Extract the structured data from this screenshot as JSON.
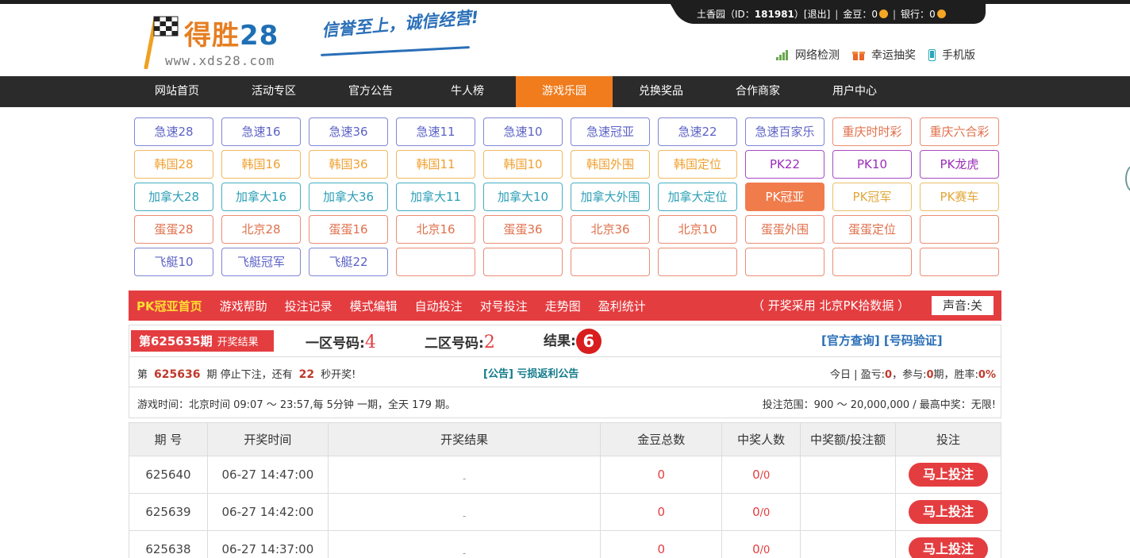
{
  "header": {
    "logo_name": "得胜",
    "logo_num": "28",
    "logo_url": "www.xds28.com",
    "slogan": "信誉至上，诚信经营!",
    "user": {
      "name": "土香园",
      "id_label": "（ID：",
      "id": "181981",
      "id_close": "）",
      "logout": "[退出]",
      "gold_label": "金豆：",
      "gold": "0",
      "bank_label": "银行：",
      "bank": "0"
    },
    "quicklinks": [
      "网络检测",
      "幸运抽奖",
      "手机版"
    ]
  },
  "nav": [
    "网站首页",
    "活动专区",
    "官方公告",
    "牛人榜",
    "游戏乐园",
    "兑换奖品",
    "合作商家",
    "用户中心"
  ],
  "games": [
    [
      "急速28",
      "急速16",
      "急速36",
      "急速11",
      "急速10",
      "急速冠亚",
      "急速22",
      "急速百家乐",
      "重庆时时彩",
      "重庆六合彩"
    ],
    [
      "韩国28",
      "韩国16",
      "韩国36",
      "韩国11",
      "韩国10",
      "韩国外围",
      "韩国定位",
      "PK22",
      "PK10",
      "PK龙虎"
    ],
    [
      "加拿大28",
      "加拿大16",
      "加拿大36",
      "加拿大11",
      "加拿大10",
      "加拿大外围",
      "加拿大定位",
      "PK冠亚",
      "PK冠军",
      "PK赛车"
    ],
    [
      "蛋蛋28",
      "北京28",
      "蛋蛋16",
      "北京16",
      "蛋蛋36",
      "北京36",
      "北京10",
      "蛋蛋外围",
      "蛋蛋定位",
      ""
    ],
    [
      "飞艇10",
      "飞艇冠军",
      "飞艇22",
      "",
      "",
      "",
      "",
      "",
      "",
      ""
    ]
  ],
  "subnav": {
    "home": "PK冠亚首页",
    "items": [
      "游戏帮助",
      "投注记录",
      "模式编辑",
      "自动投注",
      "对号投注",
      "走势图",
      "盈利统计"
    ],
    "source": "（ 开奖采用 北京PK拾数据 ）",
    "sound": "声音:关"
  },
  "info": {
    "period": "第625635期",
    "period_label": "开奖结果",
    "zone1_label": "一区号码:",
    "zone1": "4",
    "zone2_label": "二区号码:",
    "zone2": "2",
    "result_label": "结果:",
    "result": "6",
    "official": "[官方查询] [号码验证]",
    "next_prefix": "第",
    "next_period": "625636",
    "next_mid": "期 停止下注，还有",
    "countdown": "22",
    "next_suffix": "秒开奖!",
    "notice": "[公告] 亏损返利公告",
    "today_a": "今日 | 盈亏:",
    "today_profit": "0",
    "today_b": "，参与:",
    "today_join": "0",
    "today_c": "期，胜率:",
    "today_rate": "0%",
    "game_time": "游戏时间：北京时间 09:07 ～ 23:57,每 5分钟 一期，全天 179 期。",
    "bet_range": "投注范围：900 ～ 20,000,000 / 最高中奖：无限!"
  },
  "table": {
    "headers": [
      "期 号",
      "开奖时间",
      "开奖结果",
      "金豆总数",
      "中奖人数",
      "中奖额/投注额",
      "投注"
    ],
    "rows": [
      {
        "period": "625640",
        "time": "06-27 14:47:00",
        "result": "-",
        "gold": "0",
        "winners": "0",
        "total": "/0",
        "bet": "马上投注"
      },
      {
        "period": "625639",
        "time": "06-27 14:42:00",
        "result": "-",
        "gold": "0",
        "winners": "0",
        "total": "/0",
        "bet": "马上投注"
      },
      {
        "period": "625638",
        "time": "06-27 14:37:00",
        "result": "-",
        "gold": "0",
        "winners": "0",
        "total": "/0",
        "bet": "马上投注"
      }
    ]
  }
}
